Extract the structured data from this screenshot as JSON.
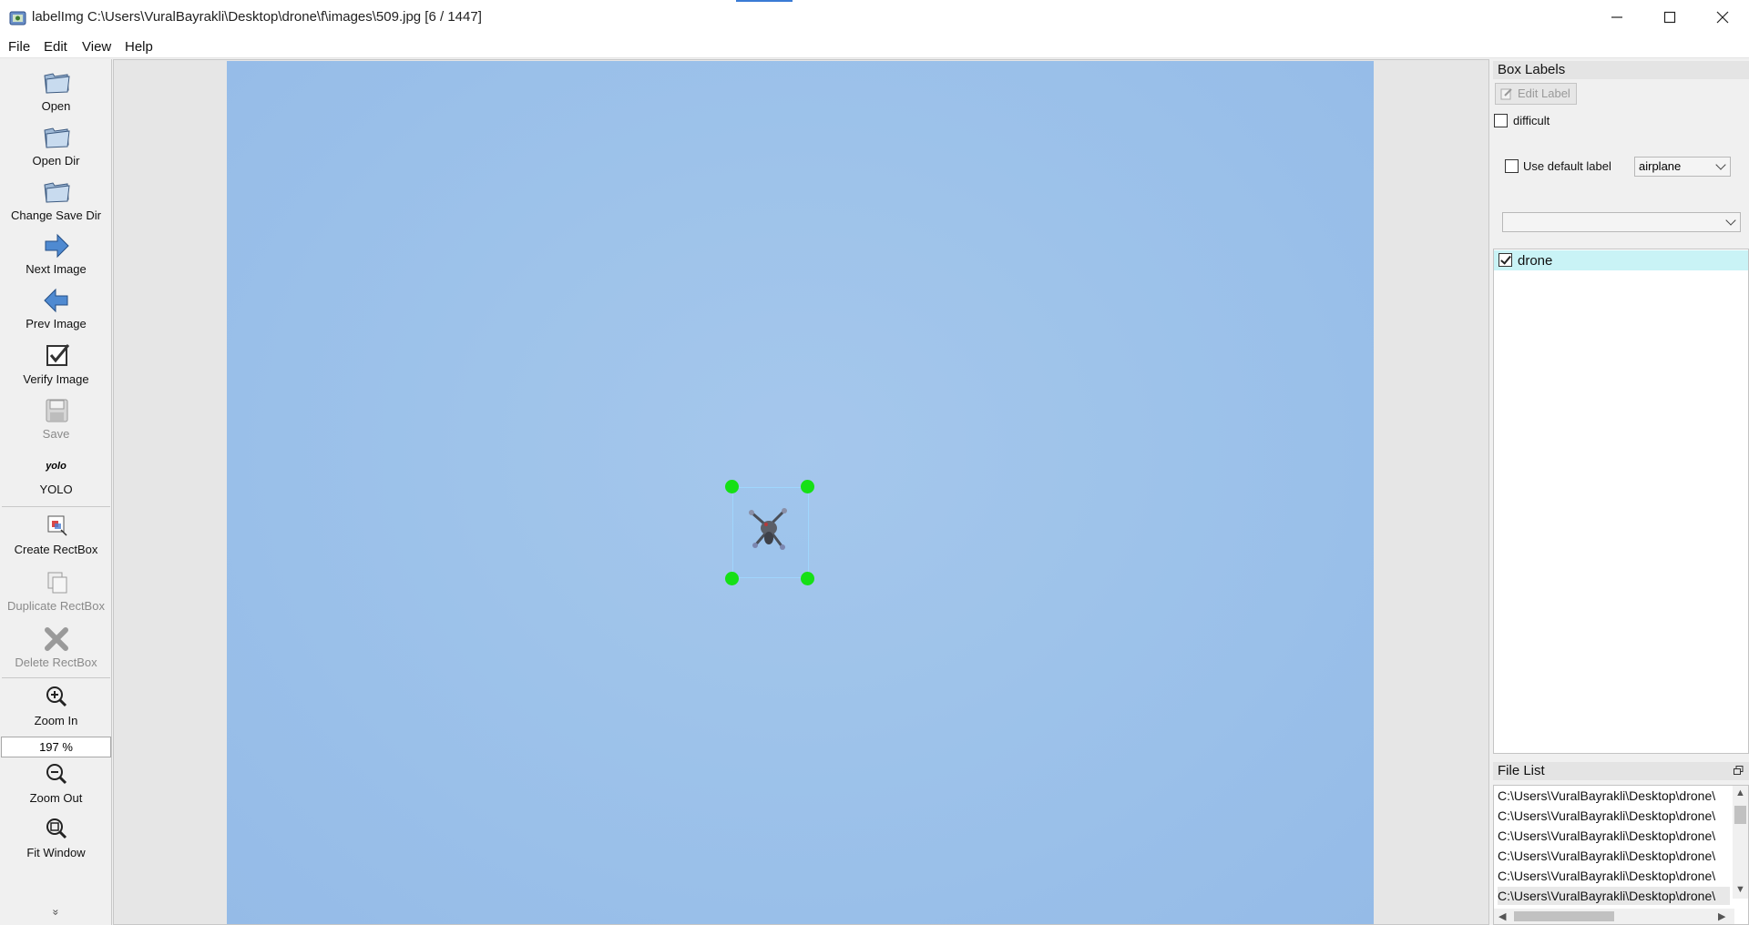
{
  "window": {
    "title": "labelImg C:\\Users\\VuralBayrakli\\Desktop\\drone\\f\\images\\509.jpg [6 / 1447]",
    "controls": [
      "minimize-icon",
      "maximize-icon",
      "close-icon"
    ]
  },
  "menu": {
    "file": "File",
    "edit": "Edit",
    "view": "View",
    "help": "Help"
  },
  "toolbar": {
    "open": "Open",
    "open_dir": "Open Dir",
    "change_save_dir": "Change Save Dir",
    "next_image": "Next Image",
    "prev_image": "Prev Image",
    "verify_image": "Verify Image",
    "save": "Save",
    "yolo_icon_text": "yolo",
    "yolo": "YOLO",
    "create_rectbox": "Create RectBox",
    "duplicate_rectbox": "Duplicate RectBox",
    "delete_rectbox": "Delete RectBox",
    "zoom_in": "Zoom In",
    "zoom_value": "197 %",
    "zoom_out": "Zoom Out",
    "fit_window": "Fit Window",
    "more": "»"
  },
  "box_labels": {
    "title": "Box Labels",
    "edit_label": "Edit Label",
    "difficult": "difficult",
    "difficult_checked": false,
    "use_default_label": "Use default label",
    "use_default_checked": false,
    "default_label_value": "airplane",
    "second_combo_value": "",
    "labels": [
      {
        "name": "drone",
        "checked": true
      }
    ]
  },
  "file_list": {
    "title": "File List",
    "items": [
      "C:\\Users\\VuralBayrakli\\Desktop\\drone\\",
      "C:\\Users\\VuralBayrakli\\Desktop\\drone\\",
      "C:\\Users\\VuralBayrakli\\Desktop\\drone\\",
      "C:\\Users\\VuralBayrakli\\Desktop\\drone\\",
      "C:\\Users\\VuralBayrakli\\Desktop\\drone\\",
      "C:\\Users\\VuralBayrakli\\Desktop\\drone\\"
    ]
  },
  "colors": {
    "sky": "#9ec3ea",
    "handle": "#16e016",
    "label_highlight": "#c9f3f6"
  }
}
